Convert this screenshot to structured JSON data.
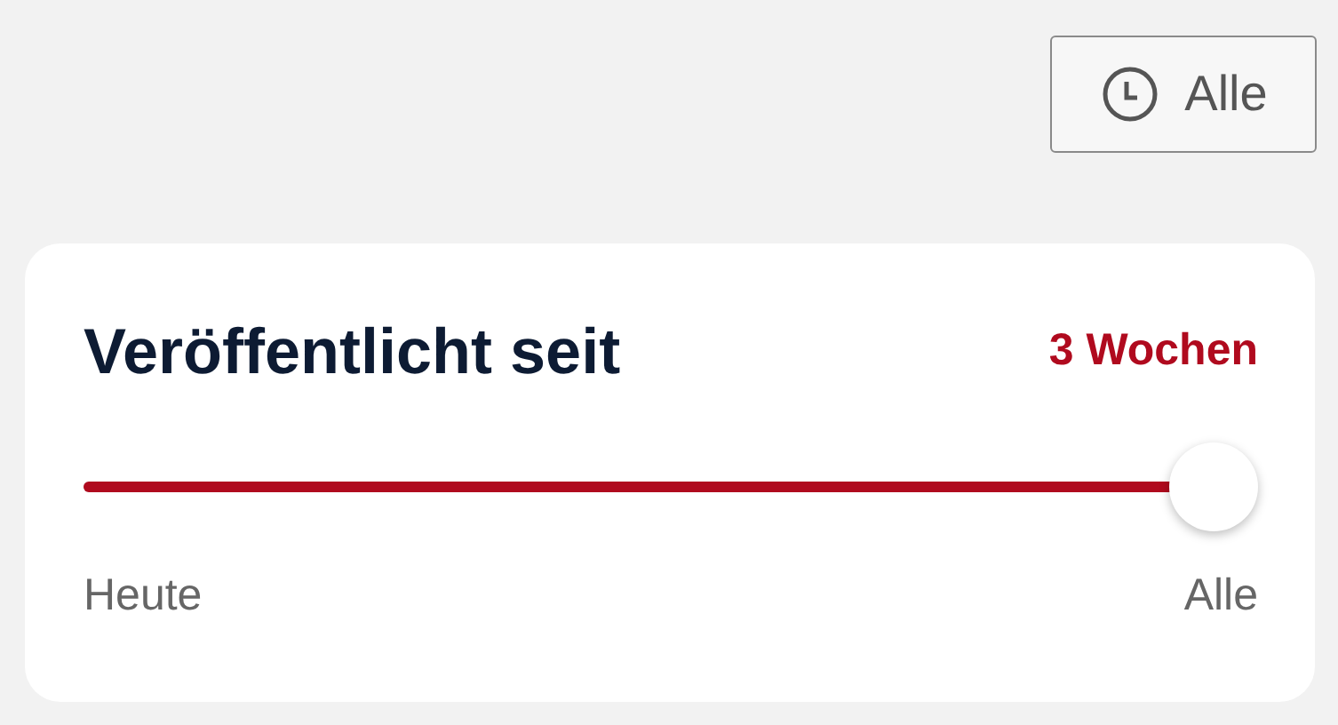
{
  "filter_button": {
    "label": "Alle"
  },
  "published_since": {
    "title": "Veröffentlicht seit",
    "reading": "3 Wochen",
    "level": 1.0,
    "min_label": "Heute",
    "max_label": "Alle"
  }
}
